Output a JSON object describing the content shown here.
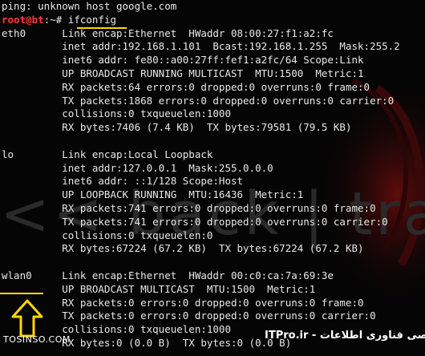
{
  "terminal": {
    "lines": [
      {
        "text": "ping: unknown host google.com"
      },
      {
        "prompt_user": "root@bt",
        "prompt_path": ":~# ",
        "cmd": "ifconfig"
      },
      {
        "text": "eth0      Link encap:Ethernet  HWaddr 08:00:27:f1:a2:fc"
      },
      {
        "text": "          inet addr:192.168.1.101  Bcast:192.168.1.255  Mask:255.2"
      },
      {
        "text": "          inet6 addr: fe80::a00:27ff:fef1:a2fc/64 Scope:Link"
      },
      {
        "text": "          UP BROADCAST RUNNING MULTICAST  MTU:1500  Metric:1"
      },
      {
        "text": "          RX packets:64 errors:0 dropped:0 overruns:0 frame:0"
      },
      {
        "text": "          TX packets:1868 errors:0 dropped:0 overruns:0 carrier:0"
      },
      {
        "text": "          collisions:0 txqueuelen:1000"
      },
      {
        "text": "          RX bytes:7406 (7.4 KB)  TX bytes:79581 (79.5 KB)"
      },
      {
        "text": ""
      },
      {
        "text": "lo        Link encap:Local Loopback"
      },
      {
        "text": "          inet addr:127.0.0.1  Mask:255.0.0.0"
      },
      {
        "text": "          inet6 addr: ::1/128 Scope:Host"
      },
      {
        "text": "          UP LOOPBACK RUNNING  MTU:16436  Metric:1"
      },
      {
        "text": "          RX packets:741 errors:0 dropped:0 overruns:0 frame:0"
      },
      {
        "text": "          TX packets:741 errors:0 dropped:0 overruns:0 carrier:0"
      },
      {
        "text": "          collisions:0 txqueuelen:0"
      },
      {
        "text": "          RX bytes:67224 (67.2 KB)  TX bytes:67224 (67.2 KB)"
      },
      {
        "text": ""
      },
      {
        "text": "wlan0     Link encap:Ethernet  HWaddr 00:c0:ca:7a:69:3e"
      },
      {
        "text": "          UP BROADCAST MULTICAST  MTU:1500  Metric:1"
      },
      {
        "text": "          RX packets:0 errors:0 dropped:0 overruns:0 frame:0"
      },
      {
        "text": "          TX packets:0 errors:0 dropped:0 overruns:0 carrier:0"
      },
      {
        "text": "          collisions:0 txqueuelen:1000"
      },
      {
        "text": "          RX bytes:0 (0.0 B)  TX bytes:0 (0.0 B)"
      }
    ]
  },
  "watermark": {
    "text": "<< back | track"
  },
  "footer": {
    "left": "TOSINSO.COM",
    "right": "انجمن تخصصی فناوری اطلاعات - ITPro.ir"
  },
  "colors": {
    "background": "#050505",
    "text": "#e8e8e8",
    "prompt_user": "#ff3b3b",
    "highlight": "#ffd700",
    "watermark_red": "#5a0a0a"
  },
  "icons": {
    "arrow": "up-arrow-icon"
  }
}
